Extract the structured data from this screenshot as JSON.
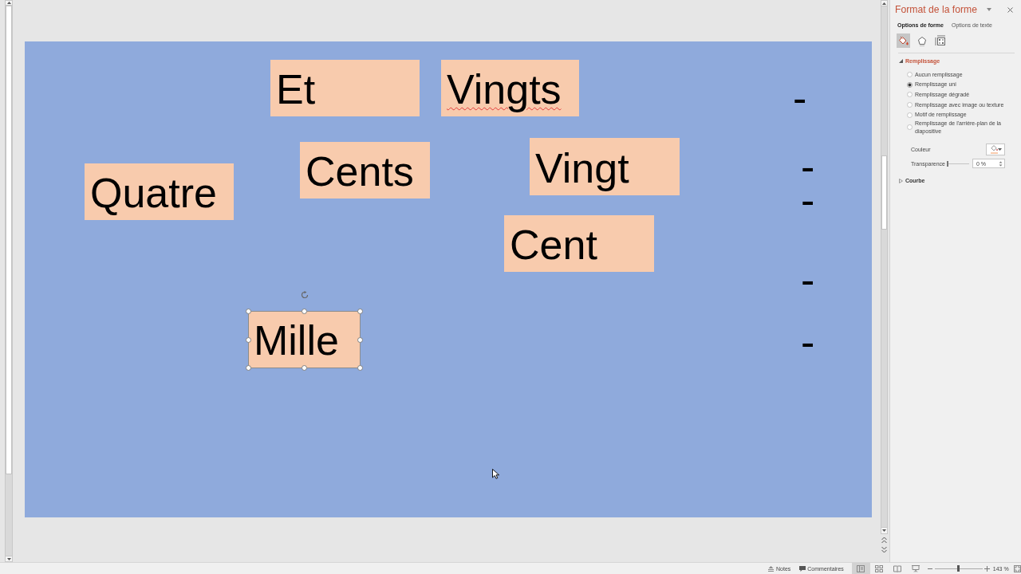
{
  "slide": {
    "shapes": [
      {
        "text": "Et",
        "selected": false,
        "spell_error": false
      },
      {
        "text": "Vingts",
        "selected": false,
        "spell_error": true
      },
      {
        "text": "Quatre",
        "selected": false,
        "spell_error": false
      },
      {
        "text": "Cents",
        "selected": false,
        "spell_error": false
      },
      {
        "text": "Vingt",
        "selected": false,
        "spell_error": false
      },
      {
        "text": "Cent",
        "selected": false,
        "spell_error": false
      },
      {
        "text": "Mille",
        "selected": true,
        "spell_error": false
      }
    ],
    "dashes": [
      "-",
      "-",
      "-",
      "-",
      "-"
    ]
  },
  "format_pane": {
    "title": "Format de la forme",
    "tabs": [
      {
        "label": "Options de forme",
        "selected": true
      },
      {
        "label": "Options de texte",
        "selected": false
      }
    ],
    "categories": [
      {
        "kind": "fill",
        "selected": true
      },
      {
        "kind": "effects",
        "selected": false
      },
      {
        "kind": "size",
        "selected": false
      }
    ],
    "sections": [
      {
        "title": "Remplissage",
        "expanded": true,
        "options": [
          {
            "label": "Aucun remplissage",
            "selected": false
          },
          {
            "label": "Remplissage uni",
            "selected": true
          },
          {
            "label": "Remplissage dégradé",
            "selected": false
          },
          {
            "label": "Remplissage avec image ou texture",
            "selected": false
          },
          {
            "label": "Motif de remplissage",
            "selected": false
          },
          {
            "label": "Remplissage de l'arrière-plan de la diapositive",
            "selected": false
          }
        ],
        "color_picker": {
          "label": "Couleur",
          "color": "#f8cbad"
        },
        "transparency": {
          "label": "Transparence",
          "level": 0,
          "value": "0 %"
        }
      },
      {
        "title": "Courbe",
        "expanded": false
      }
    ]
  },
  "status_bar": {
    "notes": "Notes",
    "comments": "Commentaires",
    "views": [
      {
        "kind": "normal",
        "selected": true
      },
      {
        "kind": "sorter",
        "selected": false
      },
      {
        "kind": "reading",
        "selected": false
      },
      {
        "kind": "slideshow",
        "selected": false
      }
    ],
    "zoom": {
      "level": 0.5,
      "value": "143 %"
    }
  }
}
